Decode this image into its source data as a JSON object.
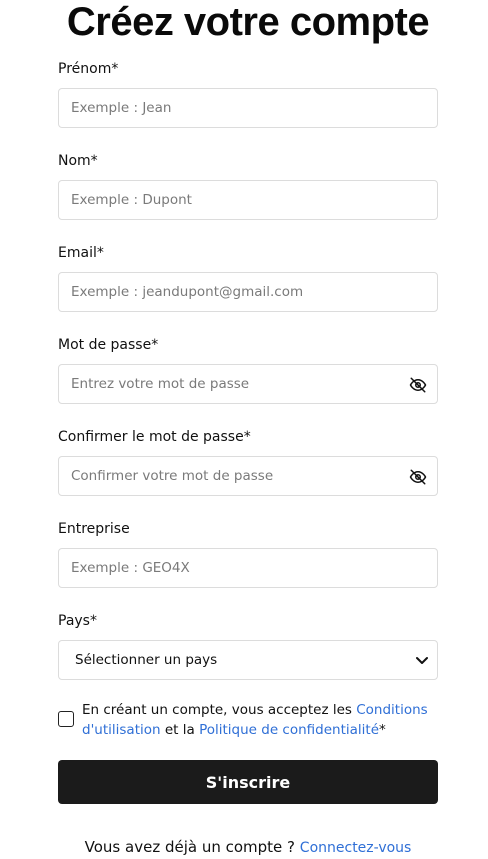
{
  "page_title": "Créez votre compte",
  "fields": {
    "first_name": {
      "label": "Prénom*",
      "placeholder": "Exemple : Jean"
    },
    "last_name": {
      "label": "Nom*",
      "placeholder": "Exemple : Dupont"
    },
    "email": {
      "label": "Email*",
      "placeholder": "Exemple : jeandupont@gmail.com"
    },
    "password": {
      "label": "Mot de passe*",
      "placeholder": "Entrez votre mot de passe",
      "icon": "eye-off-icon"
    },
    "confirm_password": {
      "label": "Confirmer le mot de passe*",
      "placeholder": "Confirmer votre mot de passe",
      "icon": "eye-off-icon"
    },
    "company": {
      "label": "Entreprise",
      "placeholder": "Exemple : GEO4X"
    },
    "country": {
      "label": "Pays*",
      "selected": "Sélectionner un pays",
      "icon": "chevron-down-icon"
    }
  },
  "consent": {
    "checked": false,
    "text_before": "En créant un compte, vous acceptez les ",
    "terms_link": "Conditions d'utilisation",
    "text_middle": " et la ",
    "privacy_link": "Politique de confidentialité",
    "text_after": "*"
  },
  "submit_label": "S'inscrire",
  "footer": {
    "text": "Vous avez déjà un compte ? ",
    "login_link": "Connectez-vous"
  },
  "colors": {
    "button_bg": "#1b1b1b",
    "link": "#2f6fd6",
    "input_border": "#dcdcdc",
    "placeholder": "#7a7a7a"
  }
}
